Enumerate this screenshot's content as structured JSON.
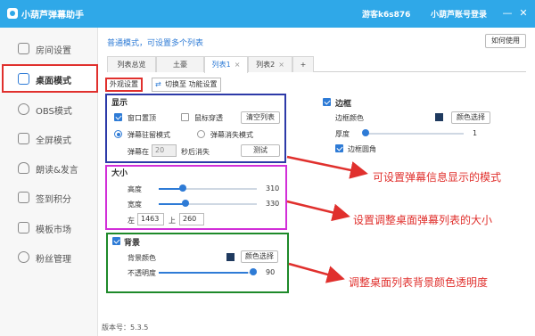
{
  "titlebar": {
    "title": "小葫芦弹幕助手",
    "guest": "游客k6s876",
    "login": "小葫芦账号登录",
    "minimize": "—",
    "close": "✕"
  },
  "sidebar": {
    "items": [
      {
        "label": "房间设置",
        "icon": "home-icon"
      },
      {
        "label": "桌面模式",
        "icon": "desktop-icon"
      },
      {
        "label": "OBS模式",
        "icon": "obs-icon"
      },
      {
        "label": "全屏模式",
        "icon": "fullscreen-icon"
      },
      {
        "label": "朗读&发言",
        "icon": "microphone-icon"
      },
      {
        "label": "签到积分",
        "icon": "checkin-icon"
      },
      {
        "label": "模板市场",
        "icon": "template-icon"
      },
      {
        "label": "粉丝管理",
        "icon": "fans-icon"
      }
    ],
    "version": "版本号：5.3.5"
  },
  "main": {
    "mode_text": "普通模式，可设置多个列表",
    "howto_label": "如何使用",
    "tabs": [
      {
        "label": "列表总览"
      },
      {
        "label": "土豪"
      },
      {
        "label": "列表1"
      },
      {
        "label": "列表2"
      },
      {
        "label": "+"
      }
    ],
    "subtabs": {
      "appearance": "外观设置",
      "switch": "切换至 功能设置"
    }
  },
  "display": {
    "title": "显示",
    "window_top": "窗口置顶",
    "mouse_through": "鼠标穿透",
    "clear_list": "清空列表",
    "resident_mode": "弹幕驻留模式",
    "vanish_mode": "弹幕消失模式",
    "vanish_prefix": "弹幕在",
    "vanish_value": "20",
    "vanish_suffix": "秒后消失",
    "test_btn": "测试"
  },
  "size": {
    "title": "大小",
    "height_label": "高度",
    "height_value": "310",
    "width_label": "宽度",
    "width_value": "330",
    "left_label": "左",
    "left_value": "1463",
    "top_label": "上",
    "top_value": "260"
  },
  "background": {
    "title": "背景",
    "color_label": "背景颜色",
    "color_btn": "颜色选择",
    "opacity_label": "不透明度",
    "opacity_value": "90"
  },
  "border": {
    "title": "边框",
    "color_label": "边框颜色",
    "color_btn": "颜色选择",
    "thickness_label": "厚度",
    "thickness_value": "1",
    "rounded_label": "边框圆角"
  },
  "annotations": {
    "display_note": "可设置弹幕信息显示的模式",
    "size_note": "设置调整桌面弹幕列表的大小",
    "background_note": "调整桌面列表背景颜色透明度"
  },
  "colors": {
    "titlebar": "#2fa8e8",
    "accent": "#2e7bd6",
    "annotation_red": "#e0302d",
    "display_box": "#2d3aa8",
    "size_box": "#d22ed8",
    "background_box": "#1e8a2a"
  }
}
